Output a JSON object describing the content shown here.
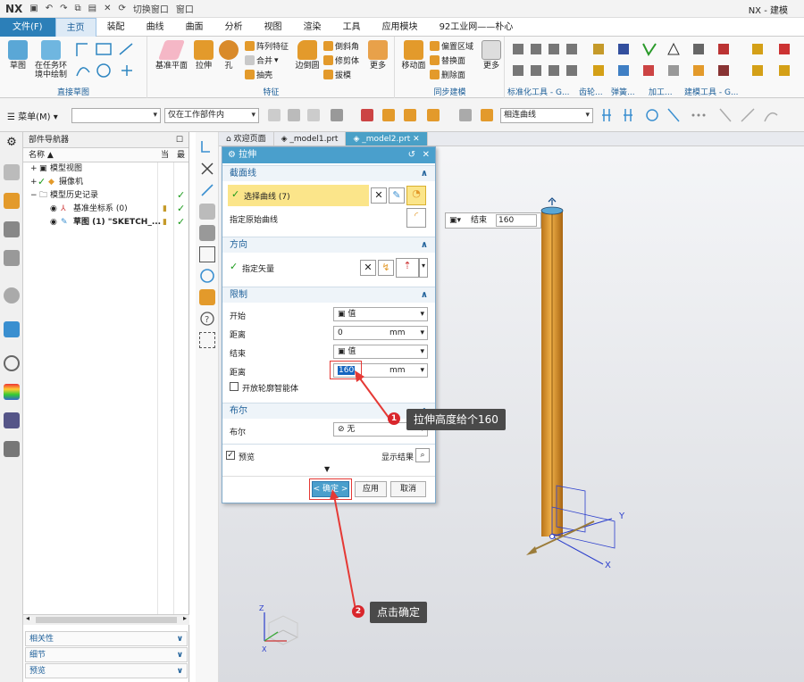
{
  "titlebar": {
    "logo": "NX",
    "switch_window": "切换窗口",
    "window_menu": "窗口",
    "app_title": "NX - 建模"
  },
  "menu_tabs": [
    "文件(F)",
    "主页",
    "装配",
    "曲线",
    "曲面",
    "分析",
    "视图",
    "渲染",
    "工具",
    "应用模块",
    "92工业网——朴心"
  ],
  "ribbon": {
    "sketch": "草图",
    "sketch_in_task_line1": "在任务环",
    "sketch_in_task_line2": "境中绘制",
    "group_direct_sketch": "直接草图",
    "datum_plane": "基准平面",
    "extrude": "拉伸",
    "hole": "孔",
    "pattern_feature": "阵列特征",
    "unite": "合并",
    "shell": "抽壳",
    "edge_blend": "边倒圆",
    "chamfer": "倒斜角",
    "trim_body": "修剪体",
    "draft": "拔模",
    "more1": "更多",
    "group_feature": "特征",
    "move_face": "移动面",
    "offset_region": "偏置区域",
    "replace_face": "替换面",
    "delete_face": "删除面",
    "more2": "更多",
    "group_sync": "同步建模",
    "group_std": "标准化工具 - G...",
    "group_gear": "齿轮...",
    "group_spring": "弹簧...",
    "group_machining": "加工...",
    "group_modeling_tools": "建模工具 - G..."
  },
  "toolbar2": {
    "menu": "菜单(M)",
    "filter_scope": "仅在工作部件内",
    "curve_rule": "相连曲线"
  },
  "navigator": {
    "title": "部件导航器",
    "col_name": "名称",
    "col_current": "当",
    "col_latest": "最",
    "model_views": "模型视图",
    "camera": "摄像机",
    "history": "模型历史记录",
    "datum_csys": "基准坐标系 (0)",
    "sketch": "草图 (1) \"SKETCH_...",
    "footer_dependencies": "相关性",
    "footer_details": "细节",
    "footer_preview": "预览"
  },
  "doc_tabs": [
    "欢迎页面",
    "_model1.prt",
    "_model2.prt"
  ],
  "dialog": {
    "title": "拉伸",
    "sec_section": "截面线",
    "select_curve": "选择曲线 (7)",
    "specify_origin_curve": "指定原始曲线",
    "sec_direction": "方向",
    "specify_vector": "指定矢量",
    "sec_limits": "限制",
    "start_label": "开始",
    "start_value": "值",
    "distance_label": "距离",
    "start_distance": "0",
    "unit": "mm",
    "end_label": "结束",
    "end_value": "值",
    "end_distance": "160",
    "open_profile": "开放轮廓智能体",
    "sec_boolean": "布尔",
    "boolean_label": "布尔",
    "boolean_value": "无",
    "preview": "预览",
    "show_result": "显示结果",
    "ok": "< 确定 >",
    "apply": "应用",
    "cancel": "取消"
  },
  "onscreen": {
    "end_label": "结束",
    "end_value": "160"
  },
  "axes": {
    "x": "X",
    "y": "Y",
    "z": "Z"
  },
  "annotations": {
    "badge1": "1",
    "callout1": "拉伸高度给个160",
    "badge2": "2",
    "callout2": "点击确定"
  },
  "colors": {
    "accent": "#4a9fcc",
    "red": "#d9262c",
    "extrude": "#e39a2b"
  }
}
